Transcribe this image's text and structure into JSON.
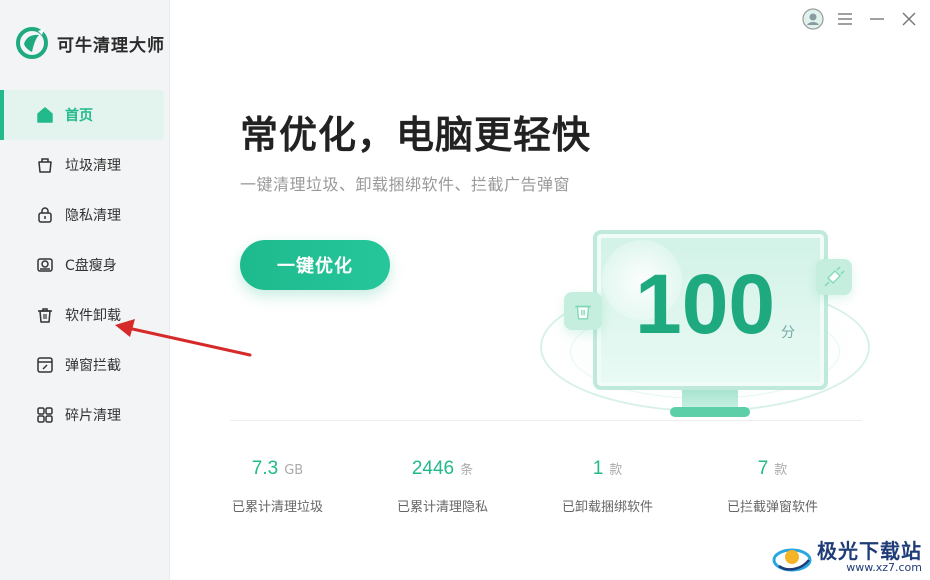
{
  "app": {
    "name": "可牛清理大师"
  },
  "sidebar": {
    "items": [
      {
        "label": "首页",
        "icon": "home-icon",
        "active": true
      },
      {
        "label": "垃圾清理",
        "icon": "bag-icon",
        "active": false
      },
      {
        "label": "隐私清理",
        "icon": "lock-icon",
        "active": false
      },
      {
        "label": "C盘瘦身",
        "icon": "disk-icon",
        "active": false
      },
      {
        "label": "软件卸载",
        "icon": "trash-icon",
        "active": false
      },
      {
        "label": "弹窗拦截",
        "icon": "popup-block-icon",
        "active": false
      },
      {
        "label": "碎片清理",
        "icon": "grid-icon",
        "active": false
      }
    ]
  },
  "main": {
    "headline": "常优化，电脑更轻快",
    "subline": "一键清理垃圾、卸载捆绑软件、拦截广告弹窗",
    "optimize_button": "一键优化",
    "score": "100",
    "score_unit": "分",
    "stats": [
      {
        "value": "7.3",
        "unit": "GB",
        "label": "已累计清理垃圾"
      },
      {
        "value": "2446",
        "unit": "条",
        "label": "已累计清理隐私"
      },
      {
        "value": "1",
        "unit": "款",
        "label": "已卸载捆绑软件"
      },
      {
        "value": "7",
        "unit": "款",
        "label": "已拦截弹窗软件"
      }
    ]
  },
  "watermark": {
    "title": "极光下载站",
    "url": "www.xz7.com"
  },
  "colors": {
    "accent": "#22b98b",
    "sidebar_bg": "#f2f4f5",
    "arrow": "#d62a2a"
  }
}
